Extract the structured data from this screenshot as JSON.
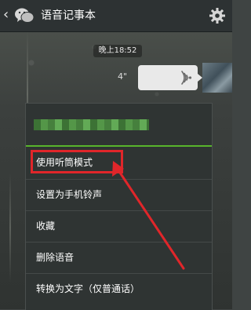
{
  "header": {
    "back_icon": "back-arrow-icon",
    "logo_icon": "wechat-logo-icon",
    "title": "语音记事本",
    "settings_icon": "gear-icon"
  },
  "chat": {
    "timestamp": "晚上18:52",
    "voice_message": {
      "duration": "4\"",
      "icon": "sound-wave-icon"
    }
  },
  "context_menu": {
    "items": [
      {
        "label": "使用听筒模式"
      },
      {
        "label": "设置为手机铃声"
      },
      {
        "label": "收藏"
      },
      {
        "label": "删除语音"
      },
      {
        "label": "转换为文字（仅普通话）"
      }
    ]
  },
  "colors": {
    "accent_green": "#58b52c",
    "annotation_red": "#e0262a",
    "menu_bg": "#2f3433",
    "topbar_bg": "#2d3233"
  }
}
